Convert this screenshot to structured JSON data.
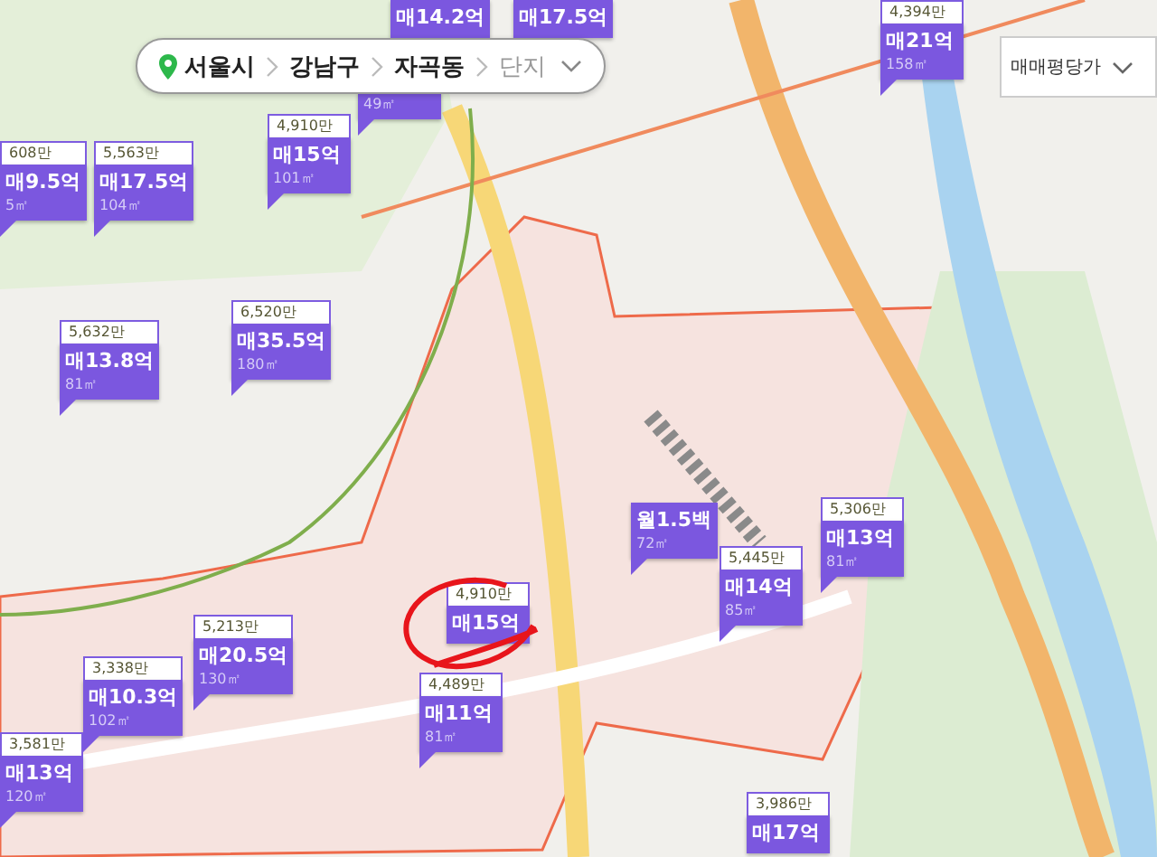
{
  "breadcrumb": [
    {
      "label": "서울시",
      "kind": "location"
    },
    {
      "label": "강남구",
      "kind": "region"
    },
    {
      "label": "자곡동",
      "kind": "region"
    },
    {
      "label": "단지",
      "kind": "select"
    }
  ],
  "price_type_select": {
    "value": "매매평당가"
  },
  "markers": [
    {
      "price": "매14.2억"
    },
    {
      "price": "매17.5억"
    },
    {
      "unit_price": "4,394만",
      "price": "매21억",
      "area": "158㎡"
    },
    {
      "area": "49㎡"
    },
    {
      "unit_price": "608만",
      "price": "매9.5억",
      "area": "5㎡"
    },
    {
      "unit_price": "5,563만",
      "price": "매17.5억",
      "area": "104㎡"
    },
    {
      "unit_price": "4,910만",
      "price": "매15억",
      "area": "101㎡"
    },
    {
      "unit_price": "5,632만",
      "price": "매13.8억",
      "area": "81㎡"
    },
    {
      "unit_price": "6,520만",
      "price": "매35.5억",
      "area": "180㎡"
    },
    {
      "price": "월1.5백",
      "area": "72㎡"
    },
    {
      "unit_price": "5,306만",
      "price": "매13억",
      "area": "81㎡"
    },
    {
      "unit_price": "5,445만",
      "price": "매14억",
      "area": "85㎡"
    },
    {
      "unit_price": "4,910만",
      "price": "매15억"
    },
    {
      "unit_price": "5,213만",
      "price": "매20.5억",
      "area": "130㎡"
    },
    {
      "unit_price": "3,338만",
      "price": "매10.3억",
      "area": "102㎡"
    },
    {
      "unit_price": "4,489만",
      "price": "매11억",
      "area": "81㎡"
    },
    {
      "unit_price": "3,581만",
      "price": "매13억",
      "area": "120㎡"
    },
    {
      "unit_price": "3,986만",
      "price": "매17억"
    }
  ]
}
